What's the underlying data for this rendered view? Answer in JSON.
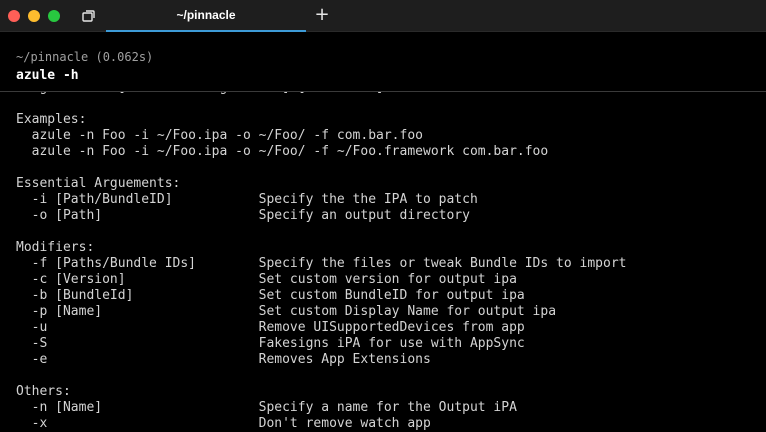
{
  "window": {
    "tab_title": "~/pinnacle",
    "new_tab_label": "+"
  },
  "block": {
    "cwd": "~/pinnacle (0.062s)",
    "command": "azule -h"
  },
  "output_lines": [
    "Usage: azule [essential arguements] [modifiers]",
    "",
    "Examples:",
    "  azule -n Foo -i ~/Foo.ipa -o ~/Foo/ -f com.bar.foo",
    "  azule -n Foo -i ~/Foo.ipa -o ~/Foo/ -f ~/Foo.framework com.bar.foo",
    "",
    "Essential Arguements:",
    "  -i [Path/BundleID]           Specify the the IPA to patch",
    "  -o [Path]                    Specify an output directory",
    "",
    "Modifiers:",
    "  -f [Paths/Bundle IDs]        Specify the files or tweak Bundle IDs to import",
    "  -c [Version]                 Set custom version for output ipa",
    "  -b [BundleId]                Set custom BundleID for output ipa",
    "  -p [Name]                    Set custom Display Name for output ipa",
    "  -u                           Remove UISupportedDevices from app",
    "  -S                           Fakesigns iPA for use with AppSync",
    "  -e                           Removes App Extensions",
    "",
    "Others:",
    "  -n [Name]                    Specify a name for the Output iPA",
    "  -x                           Don't remove watch app"
  ],
  "colors": {
    "background": "#000000",
    "titlebar": "#1e1e1e",
    "tab_accent": "#3d9bd7",
    "close": "#ff5f57",
    "minimize": "#febc2e",
    "zoom": "#28c840"
  },
  "icons": {
    "sidebar": "sidebar-toggle-icon",
    "new_tab": "plus-icon"
  }
}
